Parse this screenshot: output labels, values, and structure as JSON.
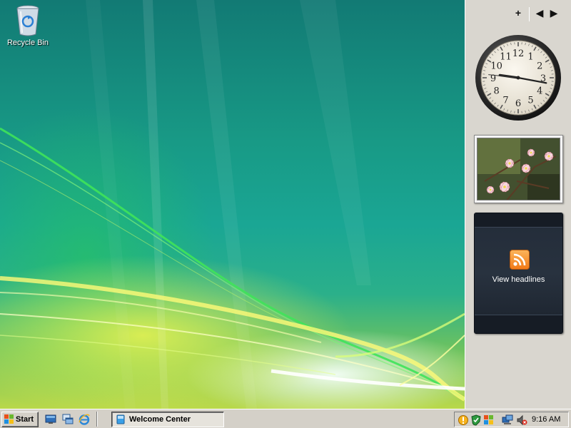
{
  "desktop": {
    "icons": [
      {
        "label": "Recycle Bin",
        "icon": "recycle-bin-icon"
      }
    ]
  },
  "sidebar": {
    "toolbar": {
      "add_label": "+",
      "prev_label": "◀",
      "next_label": "▶"
    },
    "clock": {
      "numerals": [
        "12",
        "1",
        "2",
        "3",
        "4",
        "5",
        "6",
        "7",
        "8",
        "9",
        "10",
        "11"
      ],
      "hour": 9,
      "minute": 16,
      "second": 46
    },
    "slideshow": {
      "subject": "pink-flowers-photo"
    },
    "feed": {
      "icon": "rss-feed-icon",
      "label": "View headlines"
    }
  },
  "taskbar": {
    "start_label": "Start",
    "quick_launch": [
      {
        "icon": "show-desktop-icon"
      },
      {
        "icon": "switch-windows-icon"
      },
      {
        "icon": "internet-explorer-icon"
      }
    ],
    "tasks": [
      {
        "label": "Welcome Center",
        "active": true
      }
    ],
    "tray": {
      "icons": [
        "notification-icon",
        "security-shield-icon",
        "windows-update-icon",
        "network-icon",
        "volume-muted-icon"
      ],
      "time": "9:16 AM"
    }
  },
  "colors": {
    "taskbar": "#d4d0c8",
    "sidebar": "#d9d6cf",
    "feed_background": "#242d3a",
    "rss_orange": "#f27a18"
  }
}
